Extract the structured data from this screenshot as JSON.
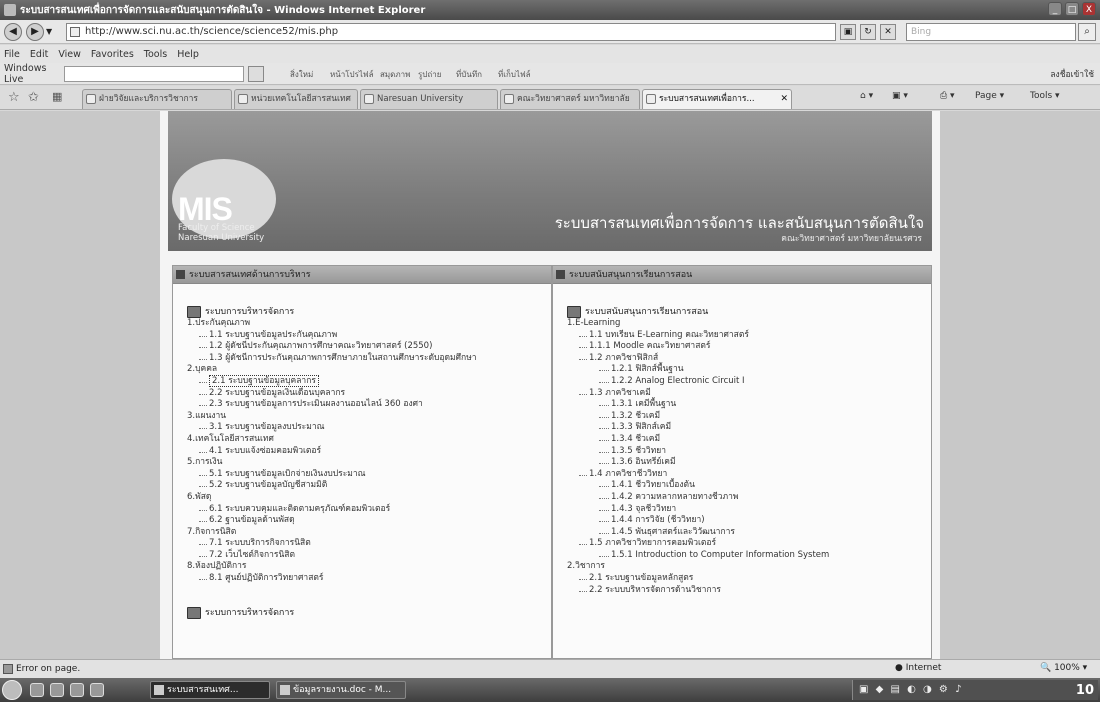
{
  "window": {
    "title": "ระบบสารสนเทศเพื่อการจัดการและสนับสนุนการตัดสินใจ - Windows Internet Explorer",
    "buttons": [
      "_",
      "□",
      "X"
    ]
  },
  "address_bar": {
    "url": "http://www.sci.nu.ac.th/science/science52/mis.php",
    "search_placeholder": "Bing"
  },
  "menu": [
    "File",
    "Edit",
    "View",
    "Favorites",
    "Tools",
    "Help"
  ],
  "live_toolbar": {
    "label": "Windows Live",
    "links": [
      "สิ่งใหม่",
      "หน้าโปรไฟล์",
      "สมุดภาพ",
      "รูปถ่าย",
      "ที่บันทึก",
      "ที่เก็บไฟล์"
    ],
    "right_label": "ลงชื่อเข้าใช้"
  },
  "tabs": [
    {
      "label": "ฝ่ายวิจัยและบริการวิชาการ",
      "active": false
    },
    {
      "label": "หน่วยเทคโนโลยีสารสนเทศ",
      "active": false
    },
    {
      "label": "Naresuan University",
      "active": false
    },
    {
      "label": "คณะวิทยาศาสตร์ มหาวิทยาลัย",
      "active": false
    },
    {
      "label": "ระบบสารสนเทศเพื่อการ...",
      "active": true
    }
  ],
  "command_bar": {
    "page": "Page",
    "tools": "Tools"
  },
  "banner": {
    "logo": "MIS",
    "faculty_line1": "Faculty of Science",
    "faculty_line2": "Naresuan University",
    "system_title": "ระบบสารสนเทศเพื่อการจัดการ และสนับสนุนการตัดสินใจ",
    "system_subtitle": "คณะวิทยาศาสตร์ มหาวิทยาลัยนเรศวร"
  },
  "left_panel": {
    "header": "ระบบสารสนเทศด้านการบริหาร",
    "section_title": "ระบบการบริหารจัดการ",
    "items": [
      {
        "level": 0,
        "text": "1.ประกันคุณภาพ"
      },
      {
        "level": 1,
        "text": "1.1 ระบบฐานข้อมูลประกันคุณภาพ"
      },
      {
        "level": 1,
        "text": "1.2 ผู้ดัชนีประกันคุณภาพการศึกษาคณะวิทยาศาสตร์ (2550)"
      },
      {
        "level": 1,
        "text": "1.3 ผู้ดัชนีการประกันคุณภาพการศึกษาภายในสถานศึกษาระดับอุดมศึกษา"
      },
      {
        "level": 0,
        "text": "2.บุคคล"
      },
      {
        "level": 1,
        "text": "2.1 ระบบฐานข้อมูลบุคลากร",
        "selected": true
      },
      {
        "level": 1,
        "text": "2.2 ระบบฐานข้อมูลเงินเดือนบุคลากร"
      },
      {
        "level": 1,
        "text": "2.3 ระบบฐานข้อมูลการประเมินผลงานออนไลน์ 360 องศา"
      },
      {
        "level": 0,
        "text": "3.แผนงาน"
      },
      {
        "level": 1,
        "text": "3.1 ระบบฐานข้อมูลงบประมาณ"
      },
      {
        "level": 0,
        "text": "4.เทคโนโลยีสารสนเทศ"
      },
      {
        "level": 1,
        "text": "4.1 ระบบแจ้งซ่อมคอมพิวเตอร์"
      },
      {
        "level": 0,
        "text": "5.การเงิน"
      },
      {
        "level": 1,
        "text": "5.1 ระบบฐานข้อมูลเบิกจ่ายเงินงบประมาณ"
      },
      {
        "level": 1,
        "text": "5.2 ระบบฐานข้อมูลบัญชีสามมิติ"
      },
      {
        "level": 0,
        "text": "6.พัสดุ"
      },
      {
        "level": 1,
        "text": "6.1 ระบบควบคุมและติดตามครุภัณฑ์คอมพิวเตอร์"
      },
      {
        "level": 1,
        "text": "6.2 ฐานข้อมูลด้านพัสดุ"
      },
      {
        "level": 0,
        "text": "7.กิจการนิสิต"
      },
      {
        "level": 1,
        "text": "7.1 ระบบบริการกิจการนิสิต"
      },
      {
        "level": 1,
        "text": "7.2 เว็บไซต์กิจการนิสิต"
      },
      {
        "level": 0,
        "text": "8.ห้องปฏิบัติการ"
      },
      {
        "level": 1,
        "text": "8.1 ศูนย์ปฏิบัติการวิทยาศาสตร์"
      }
    ],
    "footer_section": "ระบบการบริหารจัดการ"
  },
  "right_panel": {
    "header": "ระบบสนับสนุนการเรียนการสอน",
    "section_title": "ระบบสนับสนุนการเรียนการสอน",
    "items": [
      {
        "level": 0,
        "text": "1.E-Learning"
      },
      {
        "level": 1,
        "text": "1.1 บทเรียน E-Learning คณะวิทยาศาสตร์"
      },
      {
        "level": 1,
        "text": "1.1.1 Moodle คณะวิทยาศาสตร์"
      },
      {
        "level": 1,
        "text": "1.2 ภาควิชาฟิสิกส์"
      },
      {
        "level": 2,
        "text": "1.2.1 ฟิสิกส์พื้นฐาน"
      },
      {
        "level": 2,
        "text": "1.2.2 Analog Electronic Circuit I"
      },
      {
        "level": 1,
        "text": "1.3 ภาควิชาเคมี"
      },
      {
        "level": 2,
        "text": "1.3.1 เคมีพื้นฐาน"
      },
      {
        "level": 2,
        "text": "1.3.2 ชีวเคมี"
      },
      {
        "level": 2,
        "text": "1.3.3 ฟิสิกส์เคมี"
      },
      {
        "level": 2,
        "text": "1.3.4 ชีวเคมี"
      },
      {
        "level": 2,
        "text": "1.3.5 ชีววิทยา"
      },
      {
        "level": 2,
        "text": "1.3.6 อินทรีย์เคมี"
      },
      {
        "level": 1,
        "text": "1.4 ภาควิชาชีววิทยา"
      },
      {
        "level": 2,
        "text": "1.4.1 ชีววิทยาเบื้องต้น"
      },
      {
        "level": 2,
        "text": "1.4.2 ความหลากหลายทางชีวภาพ"
      },
      {
        "level": 2,
        "text": "1.4.3 จุลชีววิทยา"
      },
      {
        "level": 2,
        "text": "1.4.4 การวิจัย (ชีววิทยา)"
      },
      {
        "level": 2,
        "text": "1.4.5 พันธุศาสตร์และวิวัฒนาการ"
      },
      {
        "level": 1,
        "text": "1.5 ภาควิชาวิทยาการคอมพิวเตอร์"
      },
      {
        "level": 2,
        "text": "1.5.1 Introduction to Computer Information System"
      },
      {
        "level": 0,
        "text": "2.วิชาการ"
      },
      {
        "level": 1,
        "text": "2.1 ระบบฐานข้อมูลหลักสูตร"
      },
      {
        "level": 1,
        "text": "2.2 ระบบบริหารจัดการด้านวิชาการ"
      }
    ]
  },
  "status_bar": {
    "text": "Error on page.",
    "zone": "Internet",
    "zoom": "100%"
  },
  "taskbar": {
    "tasks": [
      {
        "label": "ระบบสารสนเทศ...",
        "active": true
      },
      {
        "label": "ข้อมูลรายงาน.doc - M...",
        "active": false
      }
    ],
    "clock": "10"
  }
}
